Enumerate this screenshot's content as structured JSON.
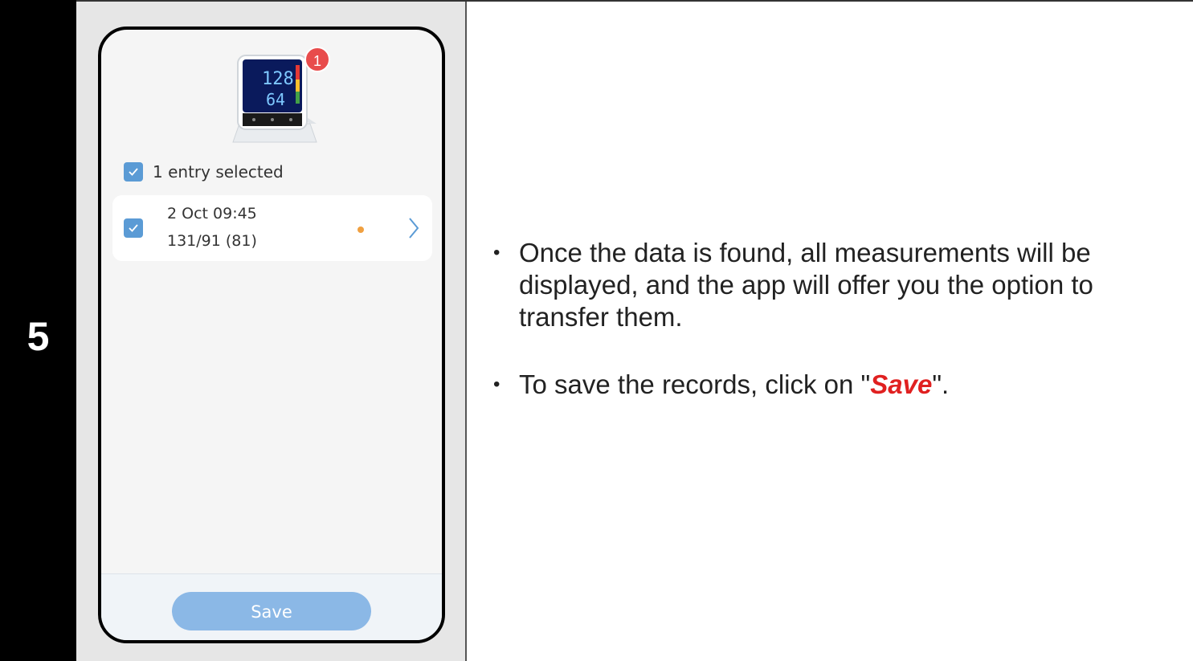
{
  "step": {
    "number": "5"
  },
  "phone": {
    "device_badge_count": "1",
    "device_display": {
      "sys": "128",
      "dia": "64"
    },
    "selection_text": "1 entry selected",
    "entry": {
      "date": "2 Oct 09:45",
      "values": "131/91 (81)",
      "status_color": "#f0a040"
    },
    "save_button_label": "Save"
  },
  "instructions": {
    "bullet_symbol": "•",
    "item1": "Once the data is found, all measurements will be displayed, and the app will offer you the option to transfer them.",
    "item2_prefix": "To save the records, click on \"",
    "item2_highlight": "Save",
    "item2_suffix": "\"."
  },
  "colors": {
    "accent": "#5b9bd5",
    "save_button": "#8bb8e6",
    "highlight": "#e02020",
    "badge": "#e84c4c"
  }
}
